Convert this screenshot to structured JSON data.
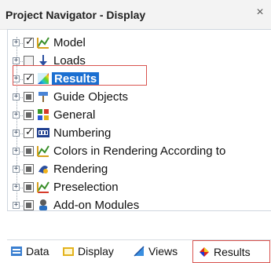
{
  "panel": {
    "title": "Project Navigator - Display",
    "close_glyph": "×"
  },
  "tree": {
    "expander_glyph": "+",
    "items": [
      {
        "label": "Model",
        "check": "checked",
        "icon": "model-icon"
      },
      {
        "label": "Loads",
        "check": "empty",
        "icon": "loads-icon"
      },
      {
        "label": "Results",
        "check": "checked",
        "icon": "results-icon",
        "selected": true
      },
      {
        "label": "Guide Objects",
        "check": "partial",
        "icon": "guide-objects-icon"
      },
      {
        "label": "General",
        "check": "partial",
        "icon": "general-icon"
      },
      {
        "label": "Numbering",
        "check": "checked",
        "icon": "numbering-icon"
      },
      {
        "label": "Colors in Rendering According to",
        "check": "partial",
        "icon": "colors-icon"
      },
      {
        "label": "Rendering",
        "check": "partial",
        "icon": "rendering-icon"
      },
      {
        "label": "Preselection",
        "check": "partial",
        "icon": "preselection-icon"
      },
      {
        "label": "Add-on Modules",
        "check": "partial",
        "icon": "addon-modules-icon"
      }
    ]
  },
  "tabs": [
    {
      "label": "Data",
      "icon": "data-icon"
    },
    {
      "label": "Display",
      "icon": "display-icon"
    },
    {
      "label": "Views",
      "icon": "views-icon"
    },
    {
      "label": "Results",
      "icon": "results-tab-icon",
      "highlighted": true
    }
  ],
  "colors": {
    "selection": "#1b6fd1",
    "highlight_frame": "#d9534f"
  }
}
